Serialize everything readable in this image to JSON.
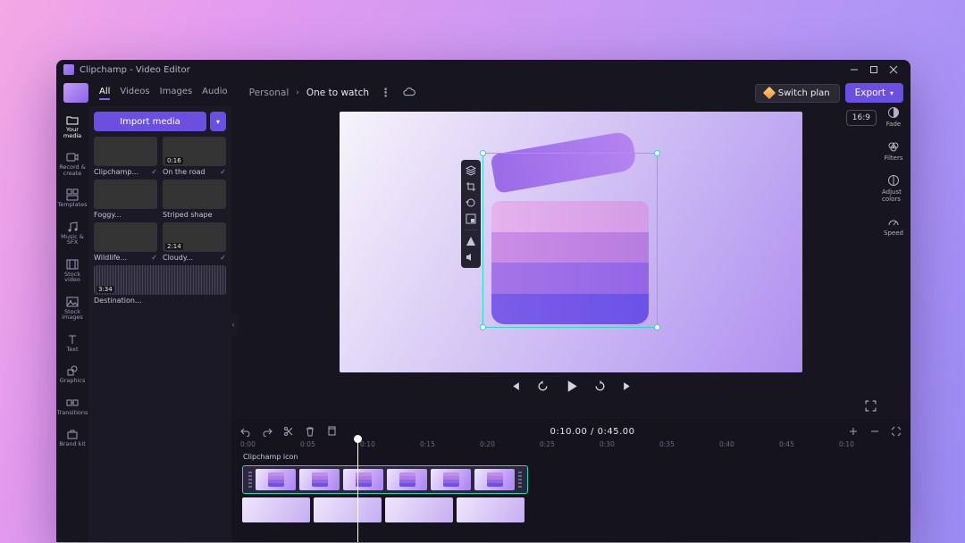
{
  "window": {
    "title": "Clipchamp - Video Editor"
  },
  "media_tabs": [
    "All",
    "Videos",
    "Images",
    "Audio"
  ],
  "media_tab_active": 0,
  "breadcrumbs": {
    "parent": "Personal",
    "current": "One to watch"
  },
  "top_actions": {
    "switch_plan": "Switch plan",
    "export": "Export"
  },
  "import_button": "Import media",
  "aspect_ratio": "16:9",
  "right_tools": [
    {
      "name": "fade",
      "label": "Fade"
    },
    {
      "name": "filters",
      "label": "Filters"
    },
    {
      "name": "adjust-colors",
      "label": "Adjust colors"
    },
    {
      "name": "speed",
      "label": "Speed"
    }
  ],
  "sidebar": [
    {
      "name": "your-media",
      "label": "Your media"
    },
    {
      "name": "record-create",
      "label": "Record & create"
    },
    {
      "name": "templates",
      "label": "Templates"
    },
    {
      "name": "music-sfx",
      "label": "Music & SFX"
    },
    {
      "name": "stock-video",
      "label": "Stock video"
    },
    {
      "name": "stock-images",
      "label": "Stock images"
    },
    {
      "name": "text",
      "label": "Text"
    },
    {
      "name": "graphics",
      "label": "Graphics"
    },
    {
      "name": "transitions",
      "label": "Transitions"
    },
    {
      "name": "brand-kit",
      "label": "Brand kit"
    }
  ],
  "media": [
    {
      "label": "Clipchamp...",
      "duration": "",
      "bg": "bg-champ",
      "used": true
    },
    {
      "label": "On the road",
      "duration": "0:16",
      "bg": "bg-road",
      "used": true
    },
    {
      "label": "Foggy...",
      "duration": "",
      "bg": "bg-foggy",
      "used": false
    },
    {
      "label": "Striped shape",
      "duration": "",
      "bg": "bg-striped",
      "used": false
    },
    {
      "label": "Wildlife...",
      "duration": "",
      "bg": "bg-wild",
      "used": true
    },
    {
      "label": "Cloudy...",
      "duration": "2:14",
      "bg": "bg-cloud",
      "used": true
    },
    {
      "label": "Destination...",
      "duration": "3:34",
      "bg": "audio",
      "used": false,
      "audio": true
    }
  ],
  "playback": {
    "current": "0:10.00",
    "total": "0:45.00",
    "separator": " / "
  },
  "timeline": {
    "clip_label": "Clipchamp icon",
    "ruler": [
      "0:00",
      "0:05",
      "0:10",
      "0:15",
      "0:20",
      "0:25",
      "0:30",
      "0:35",
      "0:40",
      "0:45",
      "0:10"
    ]
  }
}
